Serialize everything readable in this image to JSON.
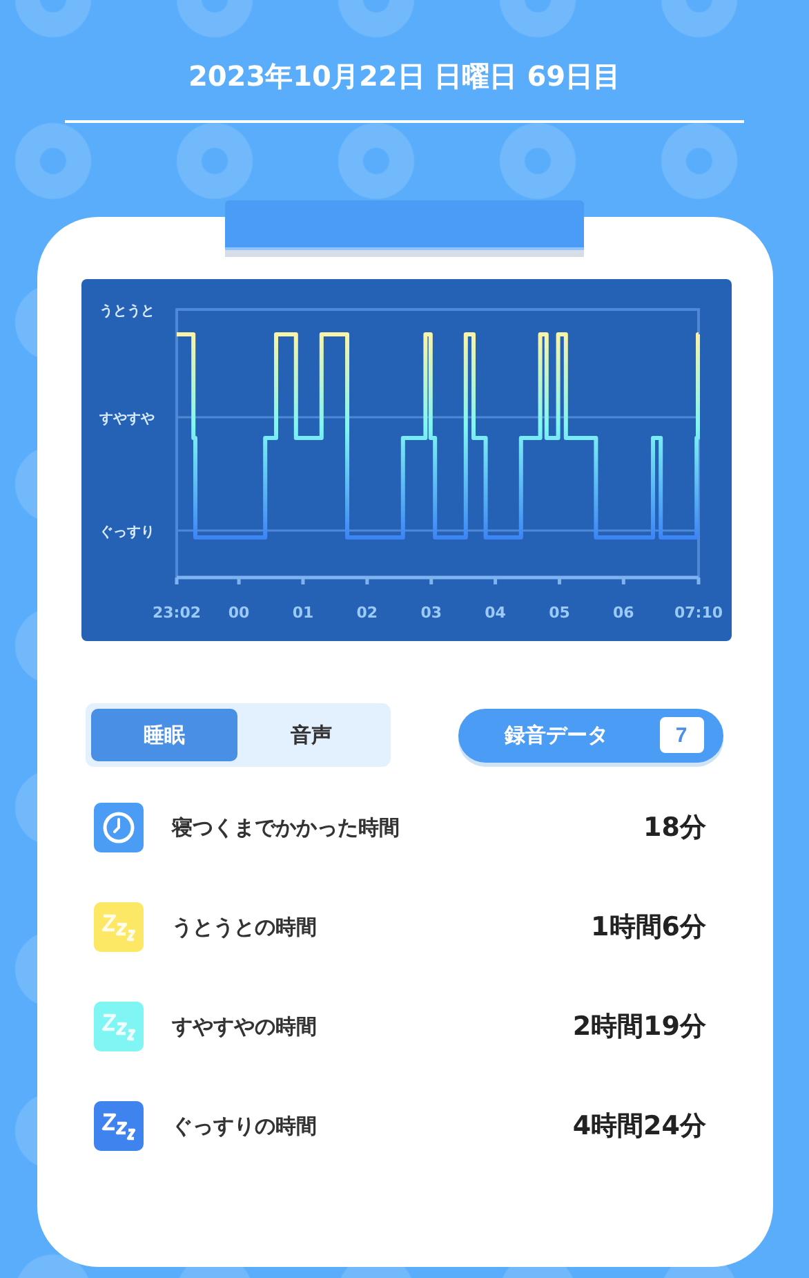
{
  "header": {
    "title": "2023年10月22日 日曜日 69日目"
  },
  "sleep_chart": {
    "stage_labels": [
      "うとうと",
      "すやすや",
      "ぐっすり"
    ],
    "time_labels": [
      "23:02",
      "00",
      "01",
      "02",
      "03",
      "04",
      "05",
      "06",
      "07:10"
    ]
  },
  "view_tabs": [
    {
      "label": "睡眠",
      "selected": true
    },
    {
      "label": "音声",
      "selected": false
    }
  ],
  "recordings_button": {
    "label": "録音データ",
    "count": "7"
  },
  "stats": [
    {
      "kind": "clock",
      "color": "#4a9cf5",
      "label": "寝つくまでかかった時間",
      "value": "18分"
    },
    {
      "kind": "sleep",
      "color": "#fde866",
      "label": "うとうとの時間",
      "value": "1時間6分"
    },
    {
      "kind": "sleep",
      "color": "#7ff6f3",
      "label": "すやすやの時間",
      "value": "2時間19分"
    },
    {
      "kind": "sleep",
      "color": "#3f83ef",
      "label": "ぐっすりの時間",
      "value": "4時間24分"
    }
  ]
}
